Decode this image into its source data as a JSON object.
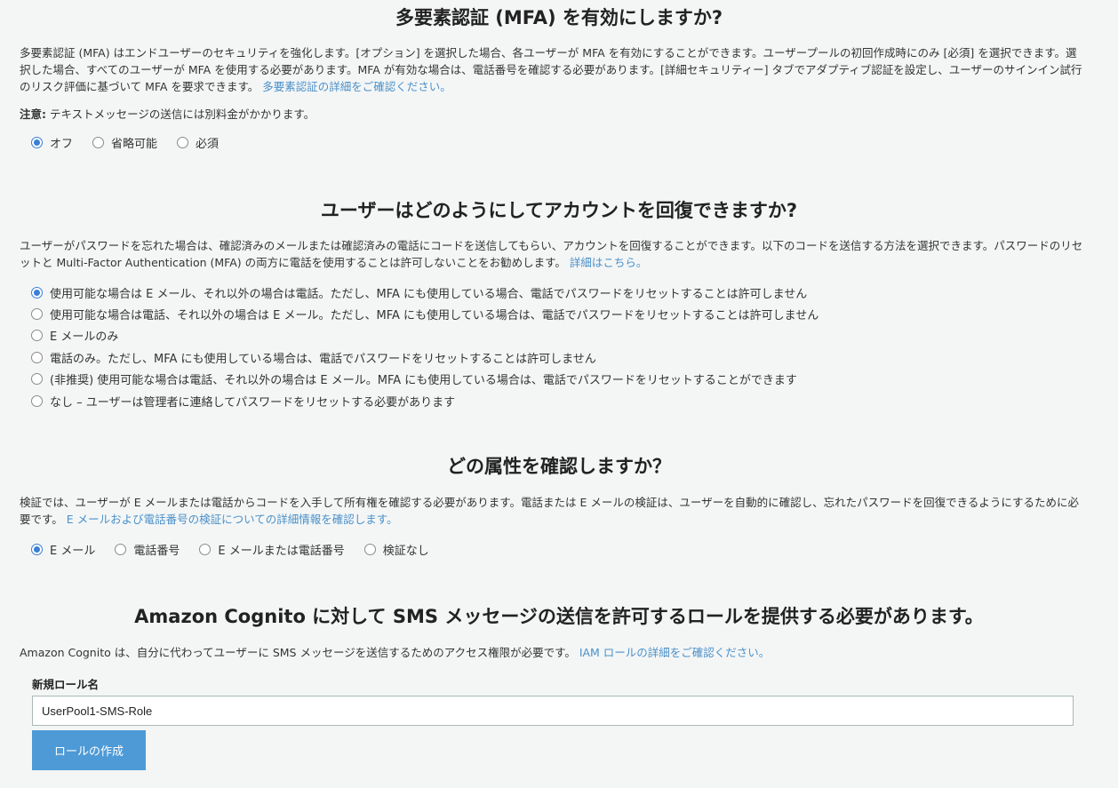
{
  "mfa": {
    "title": "多要素認証 (MFA) を有効にしますか?",
    "description": "多要素認証 (MFA) はエンドユーザーのセキュリティを強化します。[オプション] を選択した場合、各ユーザーが MFA を有効にすることができます。ユーザープールの初回作成時にのみ [必須] を選択できます。選択した場合、すべてのユーザーが MFA を使用する必要があります。MFA が有効な場合は、電話番号を確認する必要があります。[詳細セキュリティー] タブでアダプティブ認証を設定し、ユーザーのサインイン試行のリスク評価に基づいて MFA を要求できます。",
    "link": "多要素認証の詳細をご確認ください。",
    "note_label": "注意:",
    "note_text": " テキストメッセージの送信には別料金がかかります。",
    "options": [
      "オフ",
      "省略可能",
      "必須"
    ],
    "selected": 0
  },
  "recovery": {
    "title": "ユーザーはどのようにしてアカウントを回復できますか?",
    "description": "ユーザーがパスワードを忘れた場合は、確認済みのメールまたは確認済みの電話にコードを送信してもらい、アカウントを回復することができます。以下のコードを送信する方法を選択できます。パスワードのリセットと Multi-Factor Authentication (MFA) の両方に電話を使用することは許可しないことをお勧めします。",
    "link": "詳細はこちら。",
    "options": [
      "使用可能な場合は E メール、それ以外の場合は電話。ただし、MFA にも使用している場合、電話でパスワードをリセットすることは許可しません",
      "使用可能な場合は電話、それ以外の場合は E メール。ただし、MFA にも使用している場合は、電話でパスワードをリセットすることは許可しません",
      "E メールのみ",
      "電話のみ。ただし、MFA にも使用している場合は、電話でパスワードをリセットすることは許可しません",
      "(非推奨) 使用可能な場合は電話、それ以外の場合は E メール。MFA にも使用している場合は、電話でパスワードをリセットすることができます",
      "なし – ユーザーは管理者に連絡してパスワードをリセットする必要があります"
    ],
    "selected": 0
  },
  "verify": {
    "title": "どの属性を確認しますか？",
    "description": "検証では、ユーザーが E メールまたは電話からコードを入手して所有権を確認する必要があります。電話または E メールの検証は、ユーザーを自動的に確認し、忘れたパスワードを回復できるようにするために必要です。",
    "link": "E メールおよび電話番号の検証についての詳細情報を確認します。",
    "options": [
      "E メール",
      "電話番号",
      "E メールまたは電話番号",
      "検証なし"
    ],
    "selected": 0
  },
  "sms": {
    "title": "Amazon Cognito に対して SMS メッセージの送信を許可するロールを提供する必要があります。",
    "description": "Amazon Cognito は、自分に代わってユーザーに SMS メッセージを送信するためのアクセス権限が必要です。",
    "link": "IAM ロールの詳細をご確認ください。",
    "field_label": "新規ロール名",
    "role_name": "UserPool1-SMS-Role",
    "button": "ロールの作成"
  },
  "colors": {
    "link": "#4a90c9",
    "radio_checked": "#3a7fd5",
    "button": "#4d9ad6",
    "background": "#f4f6f6"
  }
}
